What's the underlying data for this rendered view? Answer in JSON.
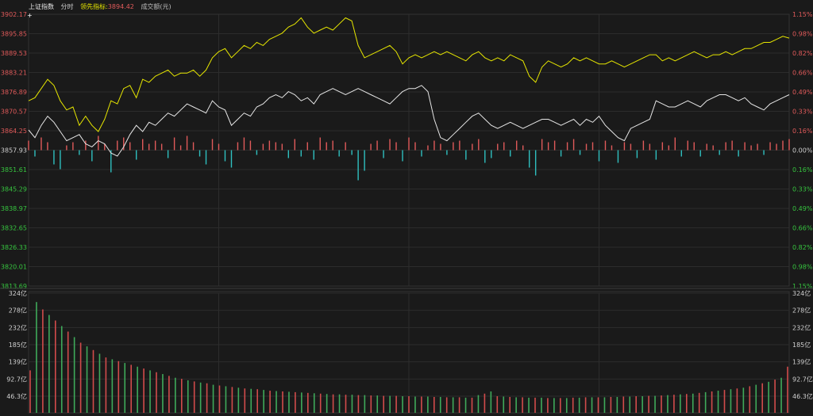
{
  "header": {
    "index_name": "上证指数",
    "mode": "分时",
    "lead_label": "领先指标",
    "lead_value": "3894.42",
    "volume_label": "成交额(元)"
  },
  "colors": {
    "background": "#1a1a1a",
    "grid": "#2c2c2c",
    "up": "#e05a5a",
    "down": "#2fbfbf",
    "price_line": "#e6e6e6",
    "lead_line": "#e6e600",
    "vol_up": "#d24b4b",
    "vol_down": "#3faa5a",
    "text_up": "#e05a5a",
    "text_down": "#36c43f",
    "text_neutral": "#cfcfcf"
  },
  "chart_data": [
    {
      "type": "line",
      "name": "intraday-price",
      "base": 3857.93,
      "y_ticks_left": [
        "3902.17",
        "3895.85",
        "3889.53",
        "3883.21",
        "3876.89",
        "3870.57",
        "3864.25",
        "3857.93",
        "3851.61",
        "3845.29",
        "3838.97",
        "3832.65",
        "3826.33",
        "3820.01",
        "3813.69"
      ],
      "y_ticks_right": [
        "1.15%",
        "0.98%",
        "0.82%",
        "0.66%",
        "0.49%",
        "0.33%",
        "0.16%",
        "0.00%",
        "0.16%",
        "0.33%",
        "0.49%",
        "0.66%",
        "0.82%",
        "0.98%",
        "1.15%"
      ],
      "ylim": [
        3813.69,
        3902.17
      ],
      "price_x": [
        0,
        2,
        4,
        6,
        8,
        10,
        12,
        14,
        16,
        18,
        20,
        22,
        24,
        26,
        28,
        30,
        32,
        34,
        36,
        38,
        40,
        42,
        44,
        46,
        48,
        50,
        52,
        54,
        56,
        58,
        60,
        62,
        64,
        66,
        68,
        70,
        72,
        74,
        76,
        78,
        80,
        82,
        84,
        86,
        88,
        90,
        92,
        94,
        96,
        98,
        100,
        102,
        104,
        106,
        108,
        110,
        112,
        114,
        116,
        118,
        120,
        122,
        124,
        126,
        128,
        130,
        132,
        134,
        136,
        138,
        140,
        142,
        144,
        146,
        148,
        150,
        152,
        154,
        156,
        158,
        160,
        162,
        164,
        166,
        168,
        170,
        172,
        174,
        176,
        178,
        180,
        182,
        184,
        186,
        188,
        190,
        192,
        194,
        196,
        198,
        200,
        202,
        204,
        206,
        208,
        210,
        212,
        214,
        216,
        218,
        220,
        222,
        224,
        226,
        228,
        230,
        232,
        234,
        236,
        238,
        240
      ],
      "price_y": [
        3864.5,
        3862,
        3866,
        3869,
        3867,
        3864,
        3861,
        3862,
        3863,
        3860,
        3859,
        3861,
        3860,
        3857,
        3856,
        3859,
        3863,
        3866,
        3864,
        3867,
        3866,
        3868,
        3870,
        3869,
        3871,
        3873,
        3872,
        3871,
        3870,
        3874,
        3872,
        3871,
        3866,
        3868,
        3870,
        3869,
        3872,
        3873,
        3875,
        3876,
        3875,
        3877,
        3876,
        3874,
        3875,
        3873,
        3876,
        3877,
        3878,
        3877,
        3876,
        3877,
        3878,
        3877,
        3876,
        3875,
        3874,
        3873,
        3875,
        3877,
        3878,
        3878,
        3879,
        3877,
        3868,
        3862,
        3861,
        3863,
        3865,
        3867,
        3869,
        3870,
        3868,
        3866,
        3865,
        3866,
        3867,
        3866,
        3865,
        3866,
        3867,
        3868,
        3868,
        3867,
        3866,
        3867,
        3868,
        3866,
        3868,
        3867,
        3869,
        3866,
        3864,
        3862,
        3861,
        3865,
        3866,
        3867,
        3868,
        3874,
        3873,
        3872,
        3872,
        3873,
        3874,
        3873,
        3872,
        3874,
        3875,
        3876,
        3876,
        3875,
        3874,
        3875,
        3873,
        3872,
        3871,
        3873,
        3874,
        3875,
        3876
      ],
      "lead_y": [
        3874,
        3875,
        3878,
        3881,
        3879,
        3874,
        3871,
        3872,
        3866,
        3869,
        3866,
        3864,
        3868,
        3874,
        3873,
        3878,
        3879,
        3875,
        3881,
        3880,
        3882,
        3883,
        3884,
        3882,
        3883,
        3883,
        3884,
        3882,
        3884,
        3888,
        3890,
        3891,
        3888,
        3890,
        3892,
        3891,
        3893,
        3892,
        3894,
        3895,
        3896,
        3898,
        3899,
        3901,
        3898,
        3896,
        3897,
        3898,
        3897,
        3899,
        3901,
        3900,
        3892,
        3888,
        3889,
        3890,
        3891,
        3892,
        3890,
        3886,
        3888,
        3889,
        3888,
        3889,
        3890,
        3889,
        3890,
        3889,
        3888,
        3887,
        3889,
        3890,
        3888,
        3887,
        3888,
        3887,
        3889,
        3888,
        3887,
        3882,
        3880,
        3885,
        3887,
        3886,
        3885,
        3886,
        3888,
        3887,
        3888,
        3887,
        3886,
        3886,
        3887,
        3886,
        3885,
        3886,
        3887,
        3888,
        3889,
        3889,
        3887,
        3888,
        3887,
        3888,
        3889,
        3890,
        3889,
        3888,
        3889,
        3889,
        3890,
        3889,
        3890,
        3891,
        3891,
        3892,
        3893,
        3893,
        3894,
        3895,
        3894.4
      ],
      "diff": [
        0.6,
        -0.4,
        0.8,
        0.5,
        -0.9,
        -1.2,
        0.3,
        0.5,
        -0.3,
        0.6,
        -0.7,
        0.9,
        0.4,
        -1.4,
        0.6,
        0.8,
        0.5,
        -0.6,
        0.7,
        0.4,
        0.6,
        0.4,
        -0.5,
        0.8,
        0.3,
        0.9,
        0.5,
        -0.4,
        -0.9,
        0.7,
        0.4,
        -0.7,
        -1.1,
        0.5,
        0.8,
        0.6,
        -0.3,
        0.4,
        0.6,
        0.5,
        0.4,
        -0.5,
        0.7,
        -0.4,
        0.5,
        -0.6,
        0.8,
        0.5,
        0.6,
        -0.4,
        0.5,
        -0.3,
        -1.9,
        -1.3,
        0.4,
        0.6,
        -0.5,
        0.7,
        0.5,
        -0.7,
        0.8,
        0.5,
        -0.4,
        0.3,
        0.6,
        0.4,
        -0.3,
        0.5,
        0.6,
        -0.6,
        0.4,
        0.7,
        -0.8,
        -0.5,
        0.4,
        0.5,
        -0.4,
        0.6,
        0.3,
        -1.1,
        -1.6,
        0.7,
        0.5,
        0.6,
        -0.4,
        0.5,
        0.7,
        -0.3,
        0.4,
        0.5,
        -0.7,
        0.6,
        0.3,
        -0.8,
        0.5,
        0.4,
        -0.5,
        0.6,
        0.4,
        -0.6,
        0.5,
        0.3,
        0.8,
        -0.4,
        0.6,
        0.5,
        -0.4,
        0.4,
        0.3,
        -0.3,
        0.5,
        0.6,
        -0.4,
        0.5,
        0.3,
        0.4,
        -0.3,
        0.5,
        0.4,
        0.6,
        0.7
      ],
      "volume_ticks": [
        "324亿",
        "278亿",
        "232亿",
        "185亿",
        "139亿",
        "92.7亿",
        "46.3亿"
      ],
      "volume_max": 324,
      "volume": [
        115,
        300,
        280,
        265,
        250,
        235,
        220,
        205,
        190,
        180,
        170,
        160,
        150,
        145,
        140,
        135,
        130,
        125,
        120,
        115,
        110,
        105,
        100,
        95,
        92,
        88,
        85,
        82,
        80,
        76,
        74,
        72,
        70,
        68,
        66,
        65,
        64,
        62,
        60,
        59,
        58,
        57,
        56,
        55,
        54,
        53,
        52,
        51,
        50,
        50,
        49,
        49,
        48,
        48,
        47,
        47,
        46,
        46,
        46,
        45,
        45,
        44,
        44,
        44,
        43,
        43,
        42,
        42,
        42,
        41,
        41,
        48,
        52,
        58,
        45,
        44,
        43,
        42,
        42,
        41,
        41,
        41,
        40,
        40,
        40,
        40,
        41,
        41,
        42,
        42,
        42,
        42,
        43,
        43,
        44,
        44,
        45,
        45,
        46,
        46,
        47,
        48,
        49,
        50,
        51,
        52,
        54,
        56,
        58,
        60,
        62,
        64,
        66,
        68,
        72,
        76,
        80,
        84,
        90,
        95,
        125
      ]
    }
  ]
}
